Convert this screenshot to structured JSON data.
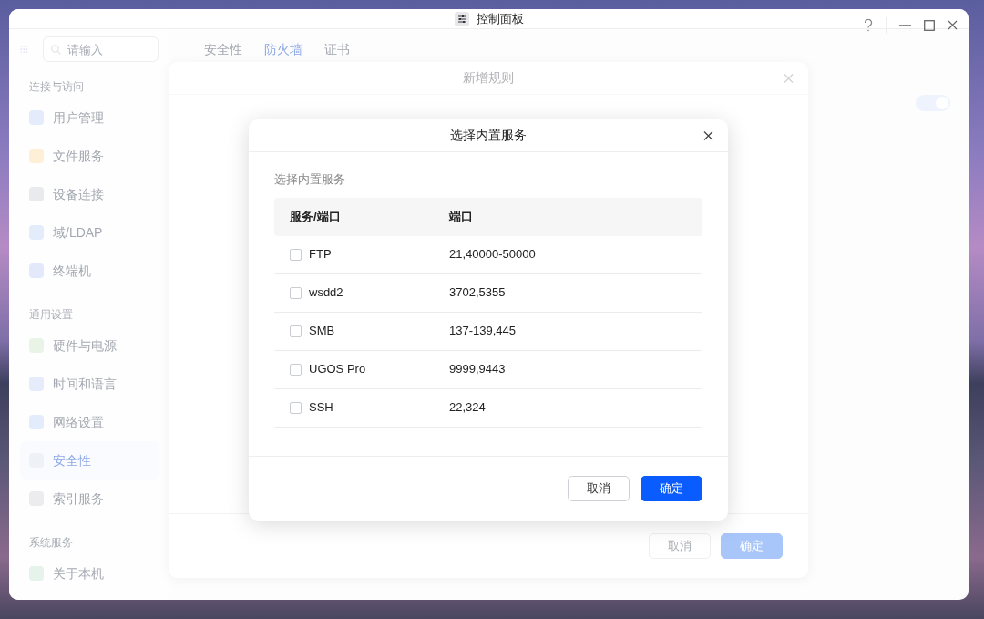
{
  "window": {
    "title": "控制面板"
  },
  "sidebar": {
    "search": {
      "placeholder": "请输入"
    },
    "groups": [
      {
        "heading": "连接与访问",
        "items": [
          {
            "label": "用户管理",
            "selected": false
          },
          {
            "label": "文件服务",
            "selected": false
          },
          {
            "label": "设备连接",
            "selected": false
          },
          {
            "label": "域/LDAP",
            "selected": false
          },
          {
            "label": "终端机",
            "selected": false
          }
        ]
      },
      {
        "heading": "通用设置",
        "items": [
          {
            "label": "硬件与电源",
            "selected": false
          },
          {
            "label": "时间和语言",
            "selected": false
          },
          {
            "label": "网络设置",
            "selected": false
          },
          {
            "label": "安全性",
            "selected": true
          },
          {
            "label": "索引服务",
            "selected": false
          }
        ]
      },
      {
        "heading": "系统服务",
        "items": [
          {
            "label": "关于本机",
            "selected": false
          }
        ]
      }
    ]
  },
  "tabs": [
    {
      "label": "安全性",
      "selected": false
    },
    {
      "label": "防火墙",
      "selected": true
    },
    {
      "label": "证书",
      "selected": false
    }
  ],
  "toggle": {
    "on": true
  },
  "rule_dialog": {
    "title": "新增规则",
    "buttons": [
      {
        "label": "取消",
        "kind": "secondary",
        "disabled": true
      },
      {
        "label": "确定",
        "kind": "primary",
        "disabled": true
      }
    ]
  },
  "service_dialog": {
    "title": "选择内置服务",
    "section_label": "选择内置服务",
    "table": {
      "columns": [
        "服务/端口",
        "端口"
      ],
      "rows": [
        {
          "service": "FTP",
          "ports": "21,40000-50000",
          "checked": false
        },
        {
          "service": "wsdd2",
          "ports": "3702,5355",
          "checked": false
        },
        {
          "service": "SMB",
          "ports": "137-139,445",
          "checked": false
        },
        {
          "service": "UGOS Pro",
          "ports": "9999,9443",
          "checked": false
        },
        {
          "service": "SSH",
          "ports": "22,324",
          "checked": false
        }
      ]
    },
    "buttons": [
      {
        "label": "取消",
        "kind": "secondary",
        "disabled": false
      },
      {
        "label": "确定",
        "kind": "primary",
        "disabled": false
      }
    ]
  }
}
